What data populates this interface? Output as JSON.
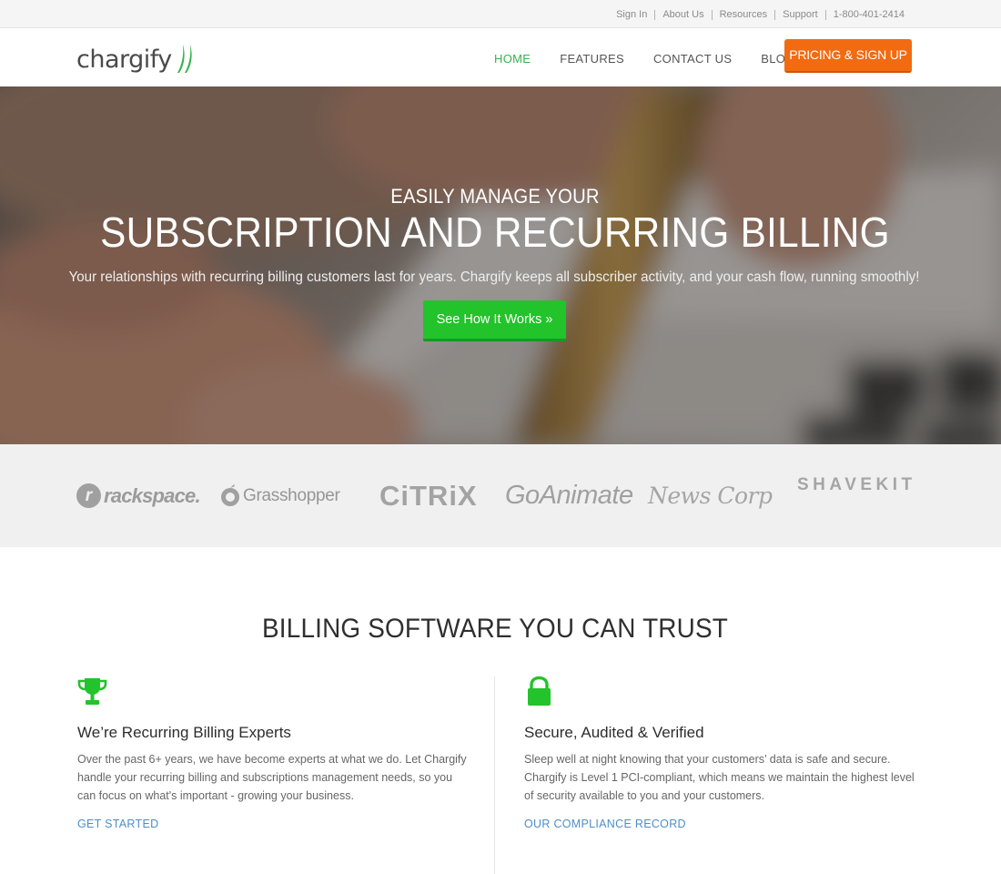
{
  "utility_nav": {
    "links": [
      "Sign In",
      "About Us",
      "Resources",
      "Support",
      "1-800-401-2414"
    ]
  },
  "brand": {
    "name": "chargify",
    "accent_green": "#36b34a",
    "cta_orange": "#f26b11"
  },
  "main_nav": {
    "items": [
      {
        "label": "HOME",
        "active": true
      },
      {
        "label": "FEATURES",
        "active": false
      },
      {
        "label": "CONTACT US",
        "active": false
      },
      {
        "label": "BLOG",
        "active": false
      }
    ],
    "cta_label": "PRICING & SIGN UP"
  },
  "hero": {
    "eyebrow": "EASILY MANAGE YOUR",
    "title": "SUBSCRIPTION AND RECURRING BILLING",
    "subtitle": "Your relationships with recurring billing customers last for years. Chargify keeps all subscriber activity, and your cash flow, running smoothly!",
    "button_label": "See How It Works »",
    "button_color": "#22c32b"
  },
  "clients": {
    "logos": [
      "rackspace.",
      "Grasshopper",
      "CiTRiX",
      "GoAnimate",
      "News Corp",
      "SHAVEKIT"
    ]
  },
  "trust": {
    "title": "BILLING SOFTWARE YOU CAN TRUST",
    "features": [
      {
        "icon": "trophy-icon",
        "title": "We’re Recurring Billing Experts",
        "body": "Over the past 6+ years, we have become experts at what we do. Let Chargify handle your recurring billing and subscriptions management needs, so you can focus on what's important - growing your business.",
        "link": "GET STARTED"
      },
      {
        "icon": "lock-icon",
        "title": "Secure, Audited & Verified",
        "body": "Sleep well at night knowing that your customers’ data is safe and secure. Chargify is Level 1 PCI-compliant, which means we maintain the highest level of security available to you and your customers.",
        "link": "OUR COMPLIANCE RECORD"
      }
    ],
    "link_color": "#4d8ec9"
  }
}
